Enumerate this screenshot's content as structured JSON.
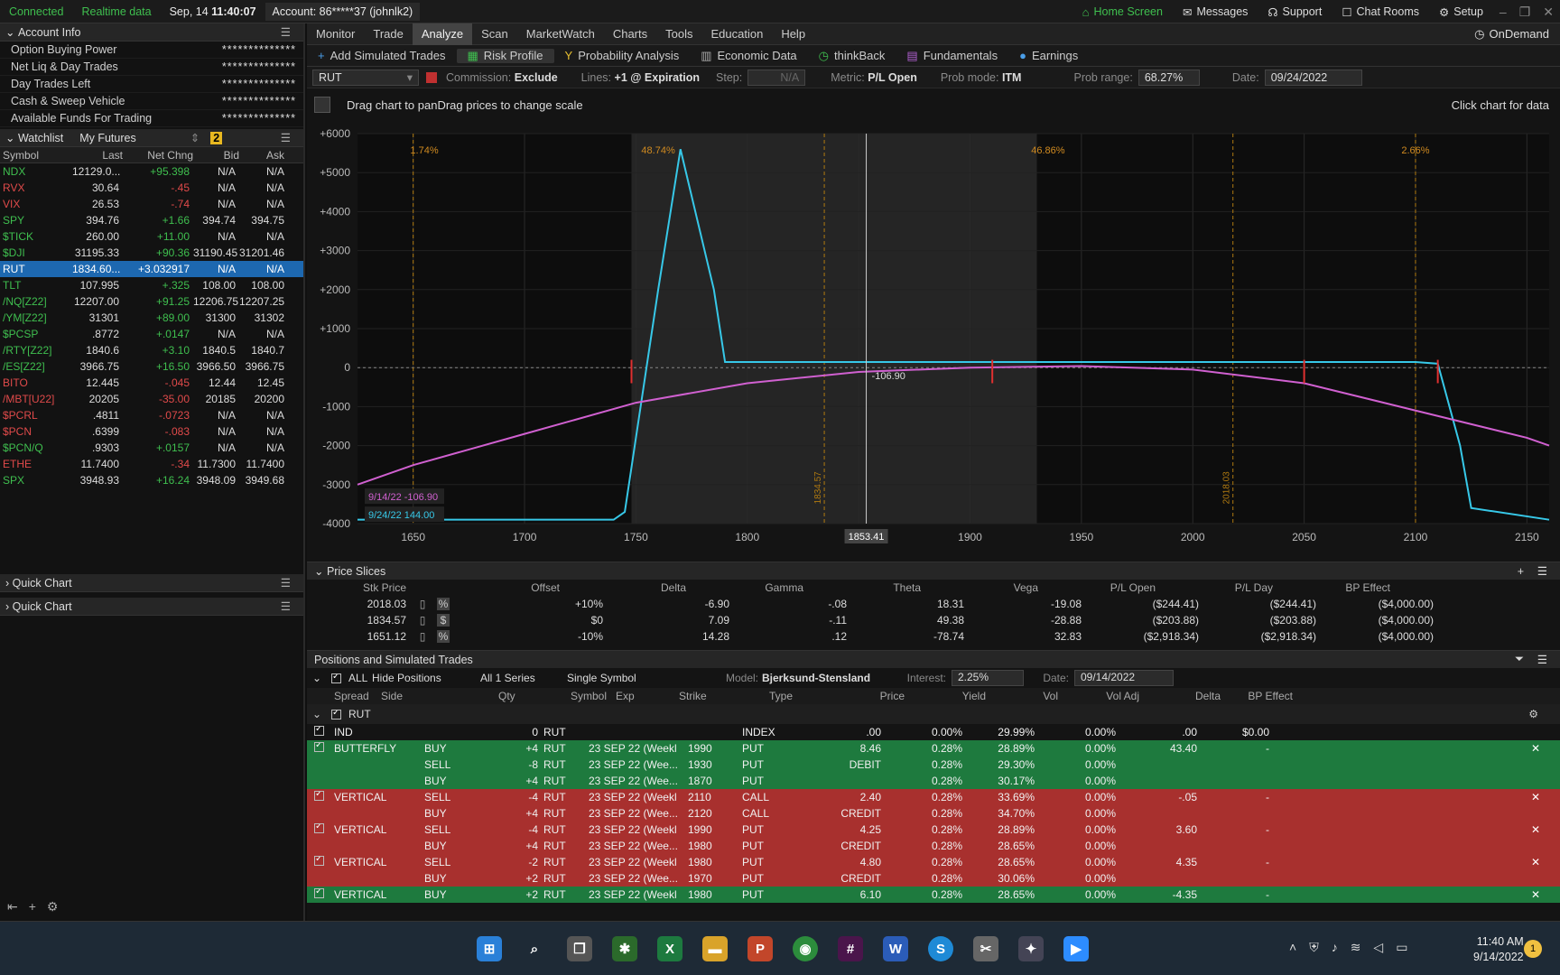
{
  "topbar": {
    "connected": "Connected",
    "realtime": "Realtime data",
    "datetime": "Sep, 14",
    "time": "11:40:07",
    "account": "Account: 86*****37 (johnlk2)",
    "home": "Home Screen",
    "messages": "Messages",
    "support": "Support",
    "chat": "Chat Rooms",
    "setup": "Setup"
  },
  "account": {
    "title": "Account Info",
    "rows": [
      {
        "label": "Option Buying Power",
        "value": "**************"
      },
      {
        "label": "Net Liq & Day Trades",
        "value": "**************"
      },
      {
        "label": "Day Trades Left",
        "value": "**************"
      },
      {
        "label": "Cash & Sweep Vehicle",
        "value": "**************"
      },
      {
        "label": "Available Funds For Trading",
        "value": "**************"
      }
    ]
  },
  "watchlist": {
    "title": "Watchlist",
    "list": "My Futures",
    "badge": "2",
    "headers": [
      "Symbol",
      "Last",
      "Net Chng",
      "Bid",
      "Ask"
    ],
    "rows": [
      {
        "sym": "NDX",
        "last": "12129.0...",
        "chg": "+95.398",
        "bid": "N/A",
        "ask": "N/A",
        "color": "#3fbf4f"
      },
      {
        "sym": "RVX",
        "last": "30.64",
        "chg": "-.45",
        "bid": "N/A",
        "ask": "N/A",
        "color": "#e04a4a"
      },
      {
        "sym": "VIX",
        "last": "26.53",
        "chg": "-.74",
        "bid": "N/A",
        "ask": "N/A",
        "color": "#e04a4a"
      },
      {
        "sym": "SPY",
        "last": "394.76",
        "chg": "+1.66",
        "bid": "394.74",
        "ask": "394.75",
        "color": "#3fbf4f"
      },
      {
        "sym": "$TICK",
        "last": "260.00",
        "chg": "+11.00",
        "bid": "N/A",
        "ask": "N/A",
        "color": "#3fbf4f"
      },
      {
        "sym": "$DJI",
        "last": "31195.33",
        "chg": "+90.36",
        "bid": "31190.45",
        "ask": "31201.46",
        "color": "#3fbf4f"
      },
      {
        "sym": "RUT",
        "last": "1834.60...",
        "chg": "+3.032917",
        "bid": "N/A",
        "ask": "N/A",
        "color": "#fff"
      },
      {
        "sym": "TLT",
        "last": "107.995",
        "chg": "+.325",
        "bid": "108.00",
        "ask": "108.00",
        "color": "#3fbf4f"
      },
      {
        "sym": "/NQ[Z22]",
        "last": "12207.00",
        "chg": "+91.25",
        "bid": "12206.75",
        "ask": "12207.25",
        "color": "#3fbf4f"
      },
      {
        "sym": "/YM[Z22]",
        "last": "31301",
        "chg": "+89.00",
        "bid": "31300",
        "ask": "31302",
        "color": "#3fbf4f"
      },
      {
        "sym": "$PCSP",
        "last": ".8772",
        "chg": "+.0147",
        "bid": "N/A",
        "ask": "N/A",
        "color": "#3fbf4f"
      },
      {
        "sym": "/RTY[Z22]",
        "last": "1840.6",
        "chg": "+3.10",
        "bid": "1840.5",
        "ask": "1840.7",
        "color": "#3fbf4f"
      },
      {
        "sym": "/ES[Z22]",
        "last": "3966.75",
        "chg": "+16.50",
        "bid": "3966.50",
        "ask": "3966.75",
        "color": "#3fbf4f"
      },
      {
        "sym": "BITO",
        "last": "12.445",
        "chg": "-.045",
        "bid": "12.44",
        "ask": "12.45",
        "color": "#e04a4a"
      },
      {
        "sym": "/MBT[U22]",
        "last": "20205",
        "chg": "-35.00",
        "bid": "20185",
        "ask": "20200",
        "color": "#e04a4a"
      },
      {
        "sym": "$PCRL",
        "last": ".4811",
        "chg": "-.0723",
        "bid": "N/A",
        "ask": "N/A",
        "color": "#e04a4a"
      },
      {
        "sym": "$PCN",
        "last": ".6399",
        "chg": "-.083",
        "bid": "N/A",
        "ask": "N/A",
        "color": "#e04a4a"
      },
      {
        "sym": "$PCN/Q",
        "last": ".9303",
        "chg": "+.0157",
        "bid": "N/A",
        "ask": "N/A",
        "color": "#3fbf4f"
      },
      {
        "sym": "ETHE",
        "last": "11.7400",
        "chg": "-.34",
        "bid": "11.7300",
        "ask": "11.7400",
        "color": "#e04a4a"
      },
      {
        "sym": "SPX",
        "last": "3948.93",
        "chg": "+16.24",
        "bid": "3948.09",
        "ask": "3949.68",
        "color": "#3fbf4f"
      }
    ]
  },
  "quickchart": "Quick Chart",
  "menu": [
    "Monitor",
    "Trade",
    "Analyze",
    "Scan",
    "MarketWatch",
    "Charts",
    "Tools",
    "Education",
    "Help"
  ],
  "ondemand": "OnDemand",
  "submenu": [
    "Add Simulated Trades",
    "Risk Profile",
    "Probability Analysis",
    "Economic Data",
    "thinkBack",
    "Fundamentals",
    "Earnings"
  ],
  "controls": {
    "symbol": "RUT",
    "commission_label": "Commission:",
    "commission": "Exclude",
    "lines_label": "Lines:",
    "lines": "+1 @ Expiration",
    "step_label": "Step:",
    "step": "N/A",
    "metric_label": "Metric:",
    "metric": "P/L Open",
    "probmode_label": "Prob mode:",
    "probmode": "ITM",
    "probrange_label": "Prob range:",
    "probrange": "68.27%",
    "date_label": "Date:",
    "date": "09/24/2022"
  },
  "chart_hint": "Drag chart to panDrag prices to change scale",
  "chart_click": "Click chart for data",
  "chart_data": {
    "type": "line",
    "xlim": [
      1625,
      2160
    ],
    "ylim": [
      -4000,
      6000
    ],
    "x_ticks": [
      "1650",
      "1700",
      "1750",
      "1800",
      "1850",
      "1900",
      "1950",
      "2000",
      "2050",
      "2100",
      "2150"
    ],
    "y_ticks": [
      "+6000",
      "+5000",
      "+4000",
      "+3000",
      "+2000",
      "+1000",
      "0",
      "-1000",
      "-2000",
      "-3000",
      "-4000"
    ],
    "series": [
      {
        "color": "#37c8e8",
        "x": [
          1625,
          1740,
          1745,
          1760,
          1770,
          1785,
          1790,
          1800,
          1850,
          1900,
          1950,
          2000,
          2050,
          2100,
          2110,
          2120,
          2125,
          2160
        ],
        "y": [
          -3900,
          -3900,
          -3700,
          2000,
          5600,
          2000,
          144,
          144,
          144,
          144,
          144,
          144,
          144,
          144,
          100,
          -2000,
          -3600,
          -3900
        ]
      },
      {
        "color": "#d060d0",
        "x": [
          1625,
          1650,
          1700,
          1750,
          1800,
          1850,
          1900,
          1950,
          2000,
          2050,
          2100,
          2150,
          2160
        ],
        "y": [
          -3000,
          -2500,
          -1700,
          -900,
          -400,
          -110,
          0,
          40,
          -50,
          -400,
          -1100,
          -1800,
          -2000
        ]
      }
    ],
    "annotations": {
      "probs": [
        "1.74%",
        "48.74%",
        "46.86%",
        "2.66%"
      ],
      "cursor_value": "-106.90",
      "cursor_x": "1853.41",
      "v1": "1834.57",
      "v2": "2018.03",
      "legend": [
        {
          "label": "9/14/22",
          "value": "-106.90",
          "color": "#d060d0"
        },
        {
          "label": "9/24/22",
          "value": "144.00",
          "color": "#37c8e8"
        }
      ]
    }
  },
  "slices": {
    "title": "Price Slices",
    "headers": [
      "Stk Price",
      "Offset",
      "Delta",
      "Gamma",
      "Theta",
      "Vega",
      "P/L Open",
      "P/L Day",
      "BP Effect"
    ],
    "rows": [
      {
        "stk": "2018.03",
        "unit": "%",
        "offset": "+10%",
        "delta": "-6.90",
        "gamma": "-.08",
        "theta": "18.31",
        "vega": "-19.08",
        "plopen": "($244.41)",
        "plday": "($244.41)",
        "bp": "($4,000.00)"
      },
      {
        "stk": "1834.57",
        "unit": "$",
        "offset": "$0",
        "delta": "7.09",
        "gamma": "-.11",
        "theta": "49.38",
        "vega": "-28.88",
        "plopen": "($203.88)",
        "plday": "($203.88)",
        "bp": "($4,000.00)"
      },
      {
        "stk": "1651.12",
        "unit": "%",
        "offset": "-10%",
        "delta": "14.28",
        "gamma": ".12",
        "theta": "-78.74",
        "vega": "32.83",
        "plopen": "($2,918.34)",
        "plday": "($2,918.34)",
        "bp": "($4,000.00)"
      }
    ]
  },
  "positions": {
    "title": "Positions and Simulated Trades",
    "all": "ALL",
    "hide": "Hide Positions",
    "series": "All 1 Series",
    "single": "Single Symbol",
    "model_label": "Model:",
    "model": "Bjerksund-Stensland",
    "interest_label": "Interest:",
    "interest": "2.25%",
    "date_label": "Date:",
    "date": "09/14/2022",
    "headers": [
      "Spread",
      "Side",
      "Qty",
      "Symbol",
      "Exp",
      "Strike",
      "Type",
      "Price",
      "Yield",
      "Vol",
      "Vol Adj",
      "Delta",
      "BP Effect"
    ],
    "group": "RUT",
    "rows": [
      {
        "bg": "none",
        "spread": "IND",
        "side": "",
        "qty": "0",
        "sym": "RUT",
        "exp": "",
        "strike": "",
        "type": "INDEX",
        "price": ".00",
        "yield": "0.00%",
        "vol": "29.99%",
        "voladj": "0.00%",
        "delta": ".00",
        "bp": "$0.00"
      },
      {
        "bg": "g",
        "spread": "BUTTERFLY",
        "side": "BUY",
        "qty": "+4",
        "sym": "RUT",
        "exp": "23 SEP 22 (Weekl",
        "strike": "1990",
        "type": "PUT",
        "price": "8.46",
        "yield": "0.28%",
        "vol": "28.89%",
        "voladj": "0.00%",
        "delta": "43.40",
        "bp": "-"
      },
      {
        "bg": "g",
        "spread": "",
        "side": "SELL",
        "qty": "-8",
        "sym": "RUT",
        "exp": "23 SEP 22 (Wee...",
        "strike": "1930",
        "type": "PUT",
        "price": "DEBIT",
        "yield": "0.28%",
        "vol": "29.30%",
        "voladj": "0.00%",
        "delta": "",
        "bp": ""
      },
      {
        "bg": "g",
        "spread": "",
        "side": "BUY",
        "qty": "+4",
        "sym": "RUT",
        "exp": "23 SEP 22 (Wee...",
        "strike": "1870",
        "type": "PUT",
        "price": "",
        "yield": "0.28%",
        "vol": "30.17%",
        "voladj": "0.00%",
        "delta": "",
        "bp": ""
      },
      {
        "bg": "r",
        "spread": "VERTICAL",
        "side": "SELL",
        "qty": "-4",
        "sym": "RUT",
        "exp": "23 SEP 22 (Weekl",
        "strike": "2110",
        "type": "CALL",
        "price": "2.40",
        "yield": "0.28%",
        "vol": "33.69%",
        "voladj": "0.00%",
        "delta": "-.05",
        "bp": "-"
      },
      {
        "bg": "r",
        "spread": "",
        "side": "BUY",
        "qty": "+4",
        "sym": "RUT",
        "exp": "23 SEP 22 (Wee...",
        "strike": "2120",
        "type": "CALL",
        "price": "CREDIT",
        "yield": "0.28%",
        "vol": "34.70%",
        "voladj": "0.00%",
        "delta": "",
        "bp": ""
      },
      {
        "bg": "r",
        "spread": "VERTICAL",
        "side": "SELL",
        "qty": "-4",
        "sym": "RUT",
        "exp": "23 SEP 22 (Weekl",
        "strike": "1990",
        "type": "PUT",
        "price": "4.25",
        "yield": "0.28%",
        "vol": "28.89%",
        "voladj": "0.00%",
        "delta": "3.60",
        "bp": "-"
      },
      {
        "bg": "r",
        "spread": "",
        "side": "BUY",
        "qty": "+4",
        "sym": "RUT",
        "exp": "23 SEP 22 (Wee...",
        "strike": "1980",
        "type": "PUT",
        "price": "CREDIT",
        "yield": "0.28%",
        "vol": "28.65%",
        "voladj": "0.00%",
        "delta": "",
        "bp": ""
      },
      {
        "bg": "r",
        "spread": "VERTICAL",
        "side": "SELL",
        "qty": "-2",
        "sym": "RUT",
        "exp": "23 SEP 22 (Weekl",
        "strike": "1980",
        "type": "PUT",
        "price": "4.80",
        "yield": "0.28%",
        "vol": "28.65%",
        "voladj": "0.00%",
        "delta": "4.35",
        "bp": "-"
      },
      {
        "bg": "r",
        "spread": "",
        "side": "BUY",
        "qty": "+2",
        "sym": "RUT",
        "exp": "23 SEP 22 (Wee...",
        "strike": "1970",
        "type": "PUT",
        "price": "CREDIT",
        "yield": "0.28%",
        "vol": "30.06%",
        "voladj": "0.00%",
        "delta": "",
        "bp": ""
      },
      {
        "bg": "g",
        "spread": "VERTICAL",
        "side": "BUY",
        "qty": "+2",
        "sym": "RUT",
        "exp": "23 SEP 22 (Weekl",
        "strike": "1980",
        "type": "PUT",
        "price": "6.10",
        "yield": "0.28%",
        "vol": "28.65%",
        "voladj": "0.00%",
        "delta": "-4.35",
        "bp": "-"
      }
    ]
  },
  "taskbar": {
    "time": "11:40 AM",
    "date": "9/14/2022",
    "notif": "1"
  }
}
